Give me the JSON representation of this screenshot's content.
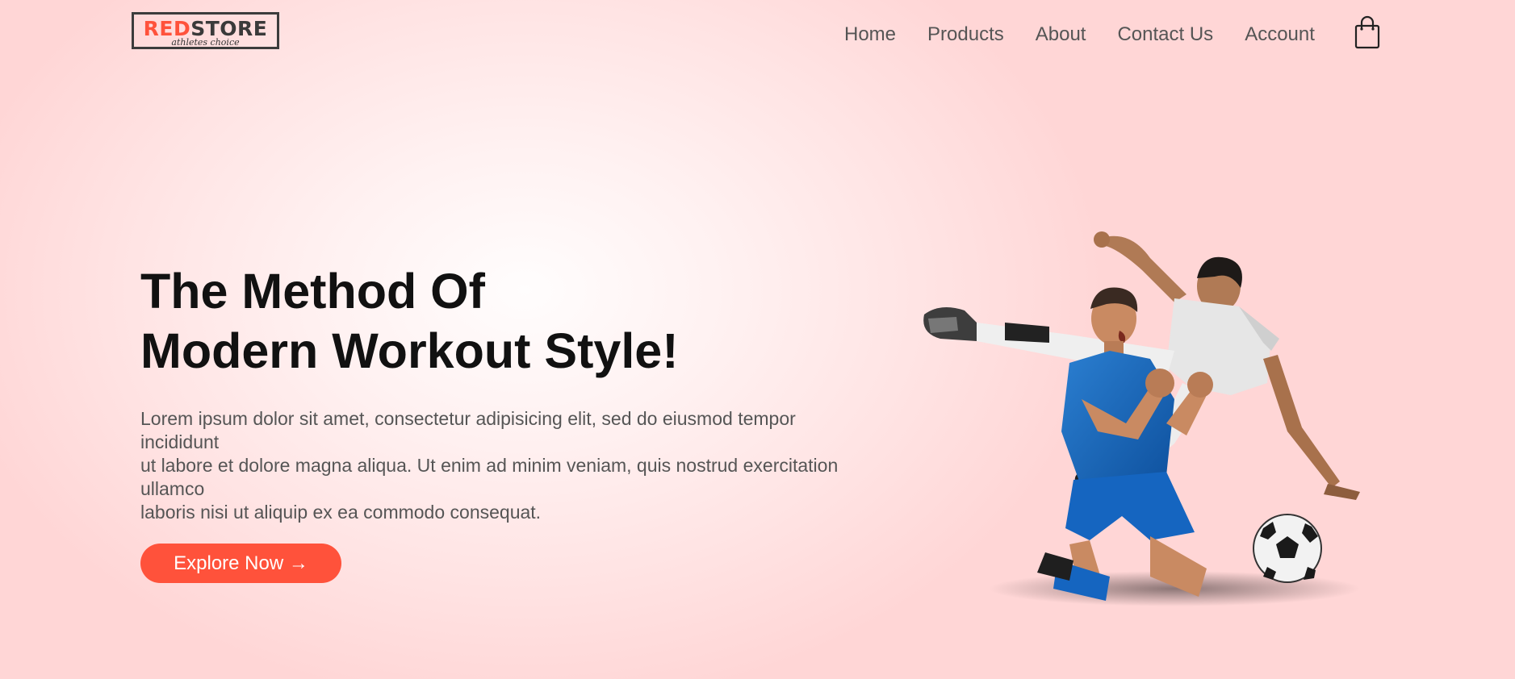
{
  "logo": {
    "part_red": "RED",
    "part_dark": "STORE",
    "tagline": "athletes choice"
  },
  "nav": {
    "items": [
      "Home",
      "Products",
      "About",
      "Contact Us",
      "Account"
    ],
    "cart_icon": "shopping-bag-icon"
  },
  "hero": {
    "title_line1": "The Method Of",
    "title_line2": "Modern Workout Style!",
    "text_lines": [
      "Lorem ipsum dolor sit amet, consectetur adipisicing elit, sed do eiusmod tempor incididunt",
      "ut labore et dolore magna aliqua. Ut enim ad minim veniam, quis nostrud exercitation ullamco",
      "laboris nisi ut aliquip ex ea commodo consequat."
    ],
    "button_label": "Explore Now →",
    "image_subject": "soccer-players-illustration"
  },
  "colors": {
    "accent": "#ff523b",
    "background": "#ffe3e3",
    "text": "#555555",
    "heading": "#111111"
  }
}
